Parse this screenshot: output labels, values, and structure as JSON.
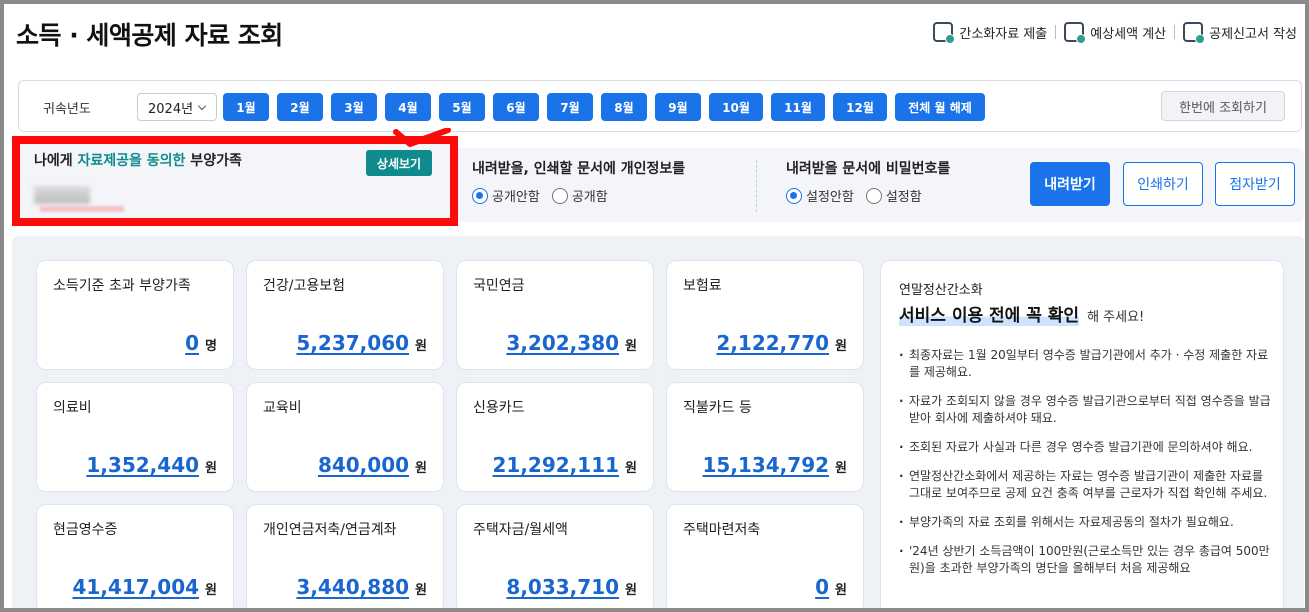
{
  "header": {
    "title": "소득 · 세액공제 자료 조회",
    "actions": [
      {
        "label": "간소화자료 제출",
        "icon": "document-check-icon"
      },
      {
        "label": "예상세액 계산",
        "icon": "calculator-icon"
      },
      {
        "label": "공제신고서 작성",
        "icon": "document-edit-icon"
      }
    ]
  },
  "filter": {
    "year_label": "귀속년도",
    "year_value": "2024년",
    "months": [
      "1월",
      "2월",
      "3월",
      "4월",
      "5월",
      "6월",
      "7월",
      "8월",
      "9월",
      "10월",
      "11월",
      "12월"
    ],
    "clear_label": "전체 월 해제",
    "lookup_all_label": "한번에 조회하기"
  },
  "dependents": {
    "title_prefix": "나에게 ",
    "title_highlight": "자료제공을 동의한",
    "title_suffix": " 부양가족",
    "detail_label": "상세보기"
  },
  "privacy": {
    "title": "내려받을, 인쇄할 문서에 개인정보를",
    "options": [
      "공개안함",
      "공개함"
    ],
    "selected": "공개안함"
  },
  "password": {
    "title": "내려받을 문서에 비밀번호를",
    "options": [
      "설정안함",
      "설정함"
    ],
    "selected": "설정안함"
  },
  "buttons": {
    "download": "내려받기",
    "print": "인쇄하기",
    "braille": "점자받기"
  },
  "cards": [
    {
      "label": "소득기준 초과 부양가족",
      "value": "0",
      "unit": "명"
    },
    {
      "label": "건강/고용보험",
      "value": "5,237,060",
      "unit": "원"
    },
    {
      "label": "국민연금",
      "value": "3,202,380",
      "unit": "원"
    },
    {
      "label": "보험료",
      "value": "2,122,770",
      "unit": "원"
    },
    {
      "label": "의료비",
      "value": "1,352,440",
      "unit": "원"
    },
    {
      "label": "교육비",
      "value": "840,000",
      "unit": "원"
    },
    {
      "label": "신용카드",
      "value": "21,292,111",
      "unit": "원"
    },
    {
      "label": "직불카드 등",
      "value": "15,134,792",
      "unit": "원"
    },
    {
      "label": "현금영수증",
      "value": "41,417,004",
      "unit": "원"
    },
    {
      "label": "개인연금저축/연금계좌",
      "value": "3,440,880",
      "unit": "원"
    },
    {
      "label": "주택자금/월세액",
      "value": "8,033,710",
      "unit": "원"
    },
    {
      "label": "주택마련저축",
      "value": "0",
      "unit": "원"
    }
  ],
  "notice": {
    "subtitle": "연말정산간소화",
    "headline": "서비스 이용 전에 꼭 확인",
    "headline_suffix": "해 주세요!",
    "items": [
      "최종자료는 1월 20일부터 영수증 발급기관에서 추가 · 수정 제출한 자료를 제공해요.",
      "자료가 조회되지 않을 경우 영수증 발급기관으로부터 직접 영수증을 발급받아 회사에 제출하셔야 돼요.",
      "조회된 자료가 사실과 다른 경우 영수증 발급기관에 문의하셔야 해요.",
      "연말정산간소화에서 제공하는 자료는 영수증 발급기관이 제출한 자료를 그대로 보여주므로 공제 요건 충족 여부를 근로자가 직접 확인해 주세요.",
      "부양가족의 자료 조회를 위해서는 자료제공동의 절차가 필요해요.",
      "'24년 상반기 소득금액이 100만원(근로소득만 있는 경우 총급여 500만원)을 초과한 부양가족의 명단을 올해부터 처음 제공해요"
    ]
  }
}
